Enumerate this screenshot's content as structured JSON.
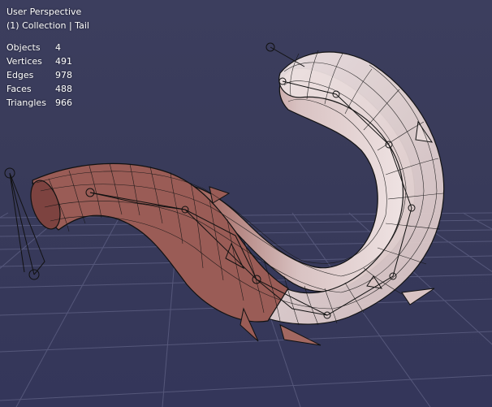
{
  "viewport": {
    "view_name": "User Perspective",
    "collection_line": "(1) Collection | Tail"
  },
  "stats": [
    {
      "label": "Objects",
      "value": "4"
    },
    {
      "label": "Vertices",
      "value": "491"
    },
    {
      "label": "Edges",
      "value": "978"
    },
    {
      "label": "Faces",
      "value": "488"
    },
    {
      "label": "Triangles",
      "value": "966"
    }
  ],
  "colors": {
    "background": "#3a3c5c",
    "grid": "#5b5d80",
    "mesh_dark": "#8a4f4a",
    "mesh_light": "#e6d8d8",
    "wire": "#111111"
  },
  "icons": [
    "empty-circle-icon",
    "bone-icon"
  ]
}
